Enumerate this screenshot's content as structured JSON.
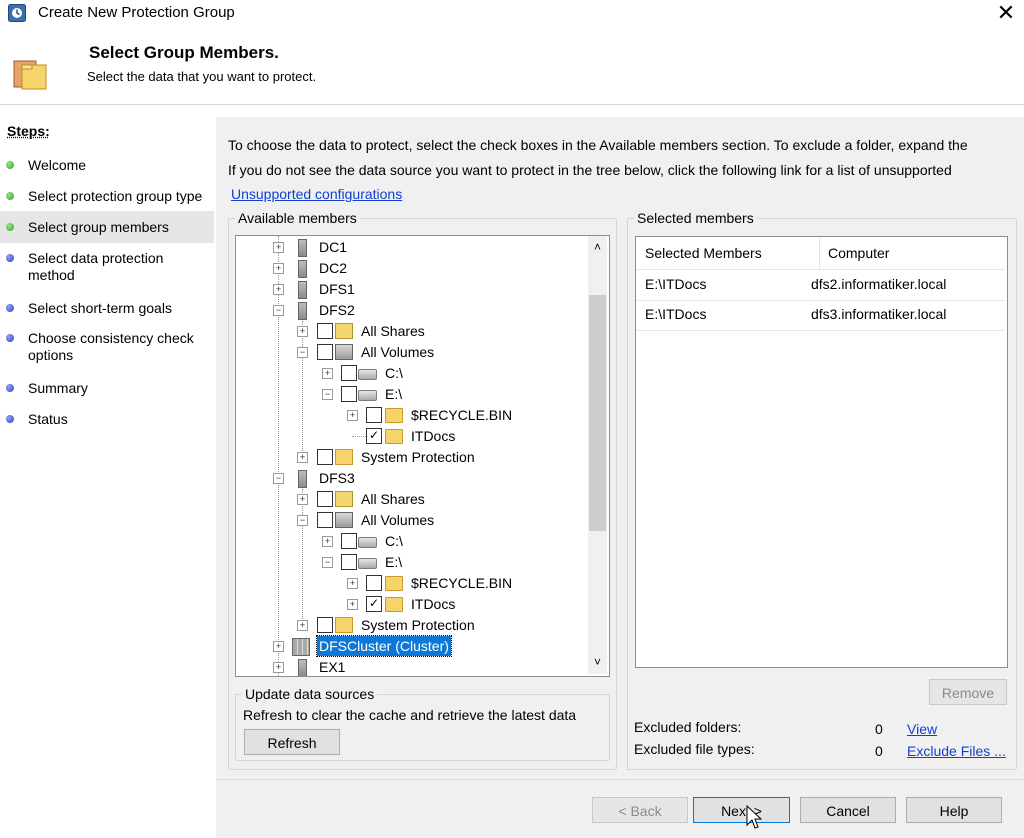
{
  "window": {
    "title": "Create New Protection Group",
    "close_icon": "close-icon"
  },
  "header": {
    "title": "Select Group Members.",
    "subtitle": "Select the data that you want to protect."
  },
  "steps": {
    "title": "Steps:",
    "items": [
      {
        "label": "Welcome",
        "status": "done"
      },
      {
        "label": "Select protection group type",
        "status": "done"
      },
      {
        "label": "Select group members",
        "status": "current"
      },
      {
        "label": "Select data protection method",
        "status": "pending"
      },
      {
        "label": "Select short-term goals",
        "status": "pending"
      },
      {
        "label": "Choose consistency check options",
        "status": "pending"
      },
      {
        "label": "Summary",
        "status": "pending"
      },
      {
        "label": "Status",
        "status": "pending"
      }
    ]
  },
  "intro": {
    "line1": "To choose the data to protect, select the check boxes in the Available members section. To exclude a folder, expand the",
    "line2": "If you do not see the data source you want to protect in the tree below, click the following link for a list of unsupported",
    "link": "Unsupported configurations"
  },
  "available": {
    "legend": "Available members",
    "tree": [
      {
        "label": "DC1"
      },
      {
        "label": "DC2"
      },
      {
        "label": "DFS1"
      },
      {
        "label": "DFS2"
      },
      {
        "label": "All Shares"
      },
      {
        "label": "All Volumes"
      },
      {
        "label": "C:\\"
      },
      {
        "label": "E:\\"
      },
      {
        "label": "$RECYCLE.BIN"
      },
      {
        "label": "ITDocs"
      },
      {
        "label": "System Protection"
      },
      {
        "label": "DFS3"
      },
      {
        "label": "All Shares"
      },
      {
        "label": "All Volumes"
      },
      {
        "label": "C:\\"
      },
      {
        "label": "E:\\"
      },
      {
        "label": "$RECYCLE.BIN"
      },
      {
        "label": "ITDocs"
      },
      {
        "label": "System Protection"
      },
      {
        "label": "DFSCluster (Cluster)"
      },
      {
        "label": "EX1"
      }
    ]
  },
  "update": {
    "legend": "Update data sources",
    "text": "Refresh to clear the cache and retrieve the latest data",
    "refresh": "Refresh"
  },
  "selected": {
    "legend": "Selected members",
    "columns": [
      "Selected Members",
      "Computer"
    ],
    "rows": [
      {
        "member": "E:\\ITDocs",
        "computer": "dfs2.informatiker.local"
      },
      {
        "member": "E:\\ITDocs",
        "computer": "dfs3.informatiker.local"
      }
    ],
    "remove": "Remove",
    "excluded_folders_label": "Excluded folders:",
    "excluded_folders_count": "0",
    "excluded_folders_link": "View",
    "excluded_types_label": "Excluded file types:",
    "excluded_types_count": "0",
    "excluded_types_link": "Exclude Files ..."
  },
  "buttons": {
    "back": "< Back",
    "next": "Next >",
    "cancel": "Cancel",
    "help": "Help"
  },
  "colors": {
    "accent": "#0078d7",
    "link": "#0f3fd3",
    "selection": "#0f78d7",
    "done_dot": "#2ea12e",
    "pending_dot": "#2f3fbd"
  }
}
